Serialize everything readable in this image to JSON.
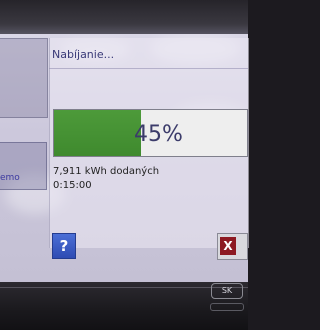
{
  "dialog": {
    "title": "Nabíjanie...",
    "progress_percent": 45,
    "progress_label": "45%",
    "energy_delivered": "7,911 kWh dodaných",
    "elapsed_time": "0:15:00"
  },
  "sidebar": {
    "partial_label": "emo"
  },
  "buttons": {
    "help_symbol": "?",
    "cancel_symbol": "X"
  },
  "hardware": {
    "button_label": "SK"
  },
  "colors": {
    "progress_fill": "#449535",
    "help_button": "#3a5ac4",
    "cancel_icon": "#8d1a22"
  }
}
